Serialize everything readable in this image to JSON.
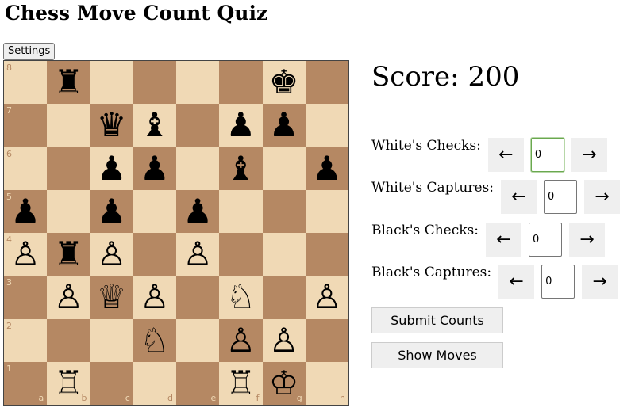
{
  "header": {
    "title": "Chess Move Count Quiz"
  },
  "toolbar": {
    "settings_label": "Settings"
  },
  "board": {
    "light_color": "#f0d9b5",
    "dark_color": "#b58863",
    "files": [
      "a",
      "b",
      "c",
      "d",
      "e",
      "f",
      "g",
      "h"
    ],
    "ranks": [
      "8",
      "7",
      "6",
      "5",
      "4",
      "3",
      "2",
      "1"
    ],
    "rows": [
      [
        "",
        "r",
        "",
        "",
        "",
        "",
        "k",
        ""
      ],
      [
        "",
        "",
        "q",
        "b",
        "",
        "p",
        "p",
        ""
      ],
      [
        "",
        "",
        "p",
        "p",
        "",
        "b",
        "",
        "p"
      ],
      [
        "p",
        "",
        "p",
        "",
        "p",
        "",
        "",
        ""
      ],
      [
        "P",
        "r",
        "P",
        "",
        "P",
        "",
        "",
        ""
      ],
      [
        "",
        "P",
        "Q",
        "P",
        "",
        "N",
        "",
        "P"
      ],
      [
        "",
        "",
        "",
        "N",
        "",
        "P",
        "P",
        ""
      ],
      [
        "",
        "R",
        "",
        "",
        "",
        "R",
        "K",
        ""
      ]
    ]
  },
  "score": {
    "text": "Score: 200"
  },
  "counters": [
    {
      "id": "white-checks",
      "label": "White's Checks:",
      "value": "0"
    },
    {
      "id": "white-captures",
      "label": "White's Captures:",
      "value": "0"
    },
    {
      "id": "black-checks",
      "label": "Black's Checks:",
      "value": "0"
    },
    {
      "id": "black-captures",
      "label": "Black's Captures:",
      "value": "0"
    }
  ],
  "arrows": {
    "left": "←",
    "right": "→"
  },
  "actions": {
    "submit_label": "Submit Counts",
    "show_label": "Show Moves"
  }
}
